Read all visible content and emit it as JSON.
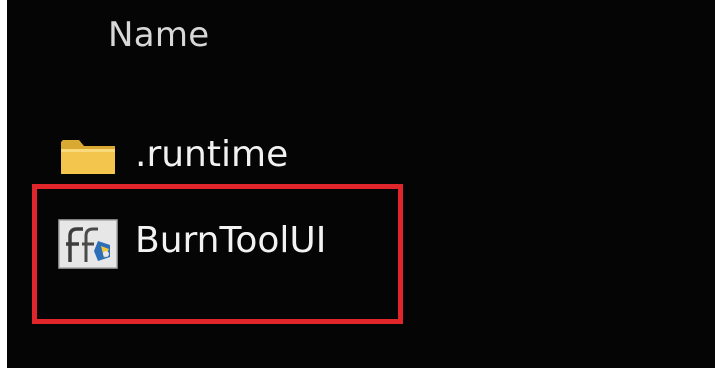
{
  "file_list": {
    "column_header": "Name",
    "items": [
      {
        "name": ".runtime",
        "type": "folder",
        "icon": "folder-icon"
      },
      {
        "name": "BurnToolUI",
        "type": "application",
        "icon": "app-icon"
      }
    ],
    "highlighted_item": "BurnToolUI"
  },
  "colors": {
    "background": "#050505",
    "text": "#f2f2f2",
    "header_text": "#d8d8d8",
    "folder": "#f3c54d",
    "highlight": "#e0262a"
  }
}
